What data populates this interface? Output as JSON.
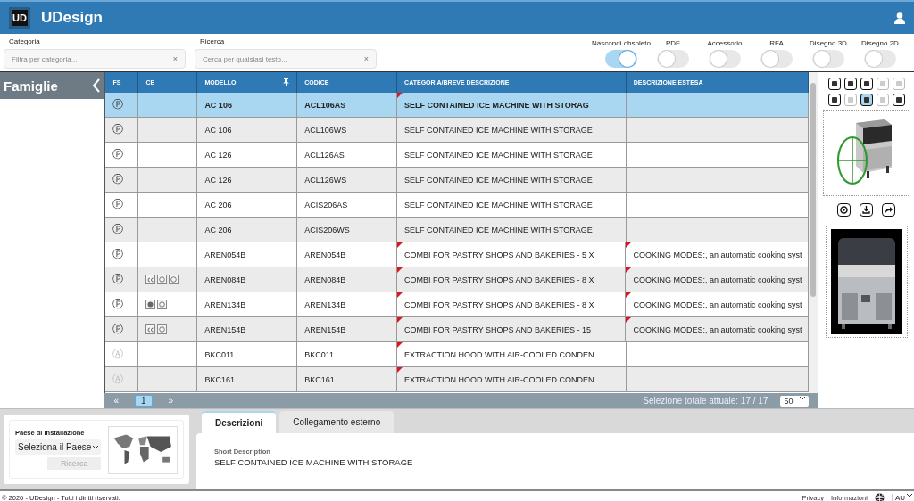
{
  "header": {
    "logo_text": "UD",
    "title": "UDesign"
  },
  "filters": [
    {
      "label": "Categoria",
      "placeholder": "Filtra per categoria...",
      "clear": "×"
    },
    {
      "label": "Ricerca",
      "placeholder": "Cerca per qualsiasi testo...",
      "clear": "×"
    }
  ],
  "toggles": [
    {
      "label": "Nascondi obsoleto",
      "on": true
    },
    {
      "label": "PDF",
      "on": false
    },
    {
      "label": "Accessorio",
      "on": false
    },
    {
      "label": "RFA",
      "on": false
    },
    {
      "label": "Disegno 3D",
      "on": false
    },
    {
      "label": "Disegno 2D",
      "on": false
    }
  ],
  "sidebar": {
    "title": "Famiglie"
  },
  "table": {
    "columns": [
      {
        "label": "FS",
        "pinned": false
      },
      {
        "label": "CE",
        "pinned": false
      },
      {
        "label": "MODELLO",
        "pinned": true
      },
      {
        "label": "CODICE",
        "pinned": false
      },
      {
        "label": "CATEGORIA/BREVE DESCRIZIONE",
        "pinned": false
      },
      {
        "label": "DESCRIZIONE ESTESA",
        "pinned": false
      }
    ],
    "rows": [
      {
        "fs": "Ⓟ",
        "obsolete": false,
        "marks": [],
        "model": "AC 106",
        "code": "ACL106AS",
        "category": "SELF CONTAINED ICE MACHINE WITH STORAG",
        "category_note": true,
        "selected": true
      },
      {
        "fs": "Ⓟ",
        "obsolete": false,
        "marks": [],
        "model": "AC 106",
        "code": "ACL106WS",
        "category": "SELF CONTAINED ICE MACHINE WITH STORAGE",
        "category_note": false,
        "selected": false
      },
      {
        "fs": "Ⓟ",
        "obsolete": false,
        "marks": [],
        "model": "AC 126",
        "code": "ACL126AS",
        "category": "SELF CONTAINED ICE MACHINE WITH STORAGE",
        "category_note": false,
        "selected": false
      },
      {
        "fs": "Ⓟ",
        "obsolete": false,
        "marks": [],
        "model": "AC 126",
        "code": "ACL126WS",
        "category": "SELF CONTAINED ICE MACHINE WITH STORAGE",
        "category_note": false,
        "selected": false
      },
      {
        "fs": "Ⓟ",
        "obsolete": false,
        "marks": [],
        "model": "AC 206",
        "code": "ACIS206AS",
        "category": "SELF CONTAINED ICE MACHINE WITH STORAGE",
        "category_note": false,
        "selected": false
      },
      {
        "fs": "Ⓟ",
        "obsolete": false,
        "marks": [],
        "model": "AC 206",
        "code": "ACIS206WS",
        "category": "SELF CONTAINED ICE MACHINE WITH STORAGE",
        "category_note": false,
        "selected": false
      },
      {
        "fs": "Ⓟ",
        "obsolete": false,
        "marks": [],
        "model": "AREN054B",
        "code": "AREN054B",
        "category": "COMBI FOR PASTRY SHOPS AND BAKERIES - 5 X",
        "category_note": true,
        "description": "COOKING MODES:, an automatic cooking syst",
        "description_note": true,
        "selected": false
      },
      {
        "fs": "Ⓟ",
        "obsolete": false,
        "marks": [
          {
            "kind": "ce"
          },
          {
            "kind": "ring"
          },
          {
            "kind": "ring"
          }
        ],
        "model": "AREN084B",
        "code": "AREN084B",
        "category": "COMBI FOR PASTRY SHOPS AND BAKERIES - 8 X",
        "category_note": true,
        "description": "COOKING MODES:, an automatic cooking syst",
        "description_note": true,
        "selected": false
      },
      {
        "fs": "Ⓟ",
        "obsolete": false,
        "marks": [
          {
            "kind": "dot"
          },
          {
            "kind": "ring"
          }
        ],
        "model": "AREN134B",
        "code": "AREN134B",
        "category": "COMBI FOR PASTRY SHOPS AND BAKERIES - 8 X",
        "category_note": true,
        "description": "COOKING MODES:, an automatic cooking syst",
        "description_note": true,
        "selected": false
      },
      {
        "fs": "Ⓟ",
        "obsolete": false,
        "marks": [
          {
            "kind": "ce"
          },
          {
            "kind": "ring"
          }
        ],
        "model": "AREN154B",
        "code": "AREN154B",
        "category": "COMBI FOR PASTRY SHOPS AND BAKERIES - 15",
        "category_note": true,
        "description": "COOKING MODES:, an automatic cooking syst",
        "description_note": true,
        "selected": false
      },
      {
        "fs": "Ⓐ",
        "obsolete": true,
        "marks": [],
        "model": "BKC011",
        "code": "BKC011",
        "category": "EXTRACTION HOOD WITH AIR-COOLED CONDEN",
        "category_note": true,
        "selected": false
      },
      {
        "fs": "Ⓐ",
        "obsolete": true,
        "marks": [],
        "model": "BKC161",
        "code": "BKC161",
        "category": "EXTRACTION HOOD WITH AIR-COOLED CONDEN",
        "category_note": true,
        "selected": false
      }
    ]
  },
  "pager": {
    "prev": "«",
    "pages": [
      {
        "label": "1",
        "selected": true
      }
    ],
    "next": "»",
    "total": "Selezione totale attuale: 17 / 17",
    "page_size": "50"
  },
  "view_buttons": [
    {
      "disabled": false,
      "selected": false
    },
    {
      "disabled": false,
      "selected": false
    },
    {
      "disabled": false,
      "selected": false
    },
    {
      "disabled": true,
      "selected": false
    },
    {
      "disabled": true,
      "selected": false
    },
    {
      "disabled": false,
      "selected": false
    },
    {
      "disabled": true,
      "selected": false
    },
    {
      "disabled": false,
      "selected": true
    },
    {
      "disabled": true,
      "selected": false
    },
    {
      "disabled": false,
      "selected": false
    }
  ],
  "country": {
    "label": "Paese di installazione",
    "select": "Seleziona il Paese",
    "button": "Ricerca",
    "button_disabled": true
  },
  "tabs": [
    {
      "label": "Descrizioni",
      "selected": true
    },
    {
      "label": "Collegamento esterno",
      "selected": false
    }
  ],
  "detail": {
    "label": "Short Description",
    "value": "SELF CONTAINED ICE MACHINE WITH STORAGE"
  },
  "footer": {
    "copyright": "© 2026 - UDesign - Tutti i diritti riservati.",
    "links": [
      "Privacy",
      "Informazioni"
    ],
    "language": "AU"
  }
}
